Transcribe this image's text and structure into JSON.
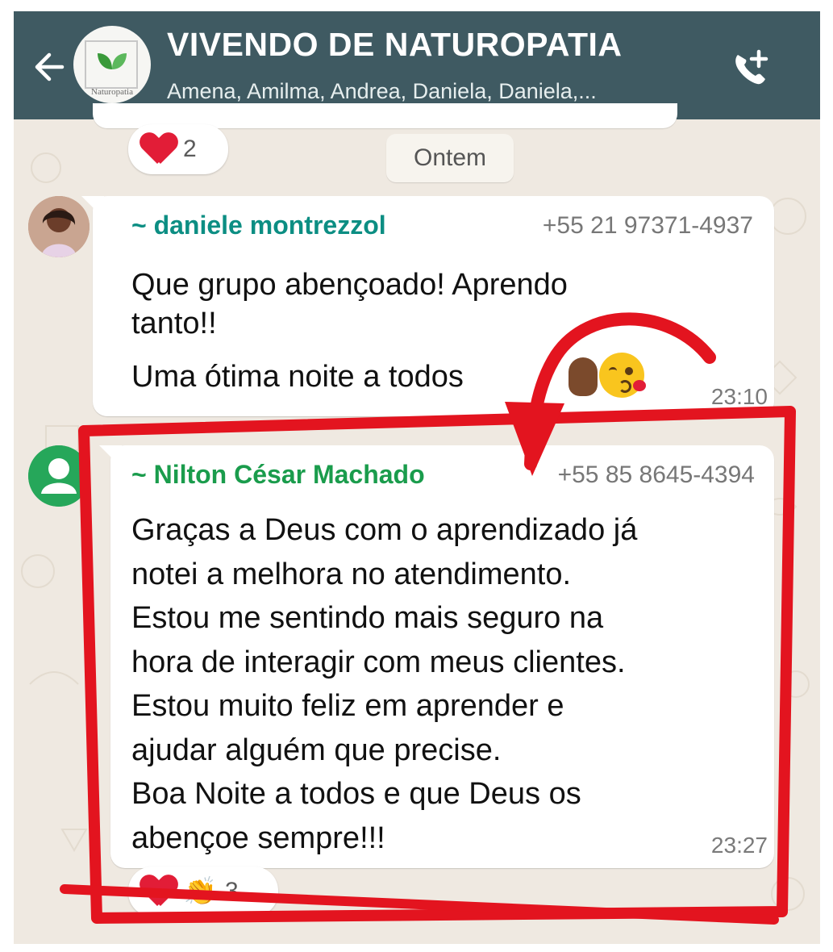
{
  "header": {
    "title": "VIVENDO DE NATUROPATIA",
    "subtitle": "Amena, Amilma, Andrea, Daniela, Daniela,...",
    "avatar_brand": "Naturopatia",
    "back_icon": "arrow-left-icon",
    "call_icon": "phone-add-icon",
    "background_color": "#3f5a62"
  },
  "chat": {
    "background_color": "#efe9e1",
    "date_separator": "Ontem",
    "top_reaction": {
      "emoji": "heart",
      "count": "2"
    },
    "messages": [
      {
        "sender": "~ daniele montrezzol",
        "sender_color": "#0c8e83",
        "phone": "+55 21 97371-4937",
        "text_lines": [
          "Que grupo abençoado! Aprendo",
          "tanto!!"
        ],
        "text_line2": "Uma ótima noite a todos",
        "emojis": [
          "raised-hand",
          "kissing-face"
        ],
        "time": "23:10"
      },
      {
        "sender": "~ Nilton César Machado",
        "sender_color": "#1a9c4c",
        "phone": "+55 85 8645-4394",
        "lines": [
          "Graças a Deus com o aprendizado já",
          "notei a melhora no atendimento.",
          "Estou me sentindo mais seguro na",
          "hora de interagir com meus clientes.",
          "Estou muito feliz em aprender e",
          "ajudar alguém que precise.",
          "Boa Noite a todos e que Deus os",
          "abençoe sempre!!!"
        ],
        "time": "23:27",
        "reactions": {
          "emojis": [
            "heart",
            "clapping-hands"
          ],
          "count": "3"
        }
      }
    ]
  },
  "annotation": {
    "color": "#e3141f",
    "shapes": [
      "arrow",
      "rectangle-highlight"
    ]
  }
}
